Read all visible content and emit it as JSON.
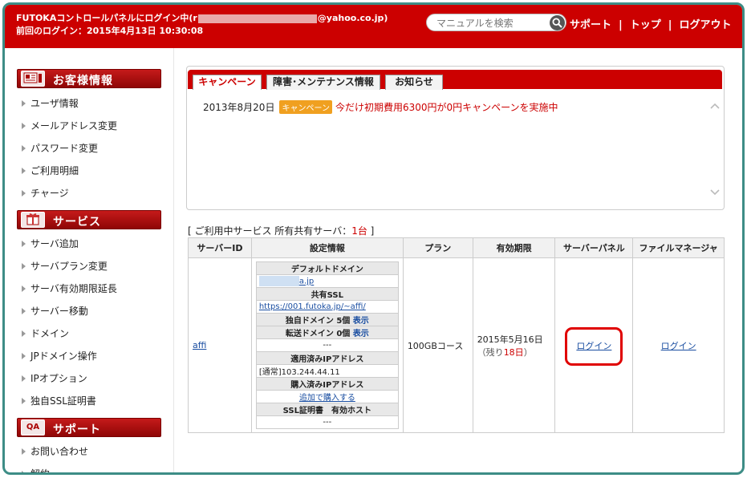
{
  "header": {
    "login_prefix": "FUTOKAコントロールパネルにログイン中(r",
    "login_suffix": "@yahoo.co.jp)",
    "last_login": "前回のログイン：2015年4月13日 10:30:08",
    "search_placeholder": "マニュアルを検索",
    "links": [
      "サポート",
      "トップ",
      "ログアウト"
    ],
    "separator": "|"
  },
  "sidebar": {
    "sections": [
      {
        "title": "お客様情報",
        "icon": "customer-card-icon",
        "items": [
          "ユーザ情報",
          "メールアドレス変更",
          "パスワード変更",
          "ご利用明細",
          "チャージ"
        ]
      },
      {
        "title": "サービス",
        "icon": "gift-box-icon",
        "items": [
          "サーバ追加",
          "サーバプラン変更",
          "サーバ有効期限延長",
          "サーバー移動",
          "ドメイン",
          "JPドメイン操作",
          "IPオプション",
          "独自SSL証明書"
        ]
      },
      {
        "title": "サポート",
        "icon_text": "QA",
        "items": [
          "お問い合わせ",
          "解約"
        ]
      }
    ]
  },
  "campaign": {
    "tabs": [
      "キャンペーン",
      "障害･メンテナンス情報",
      "お知らせ"
    ],
    "active_tab": 0,
    "news": [
      {
        "date": "2013年8月20日",
        "badge": "キャンペーン",
        "text": "今だけ初期費用6300円が0円キャンペーンを実施中"
      }
    ]
  },
  "service": {
    "caption_prefix": "[ ご利用中サービス 所有共有サーバ：",
    "caption_count": "1台",
    "caption_suffix": " ]",
    "columns": [
      "サーバーID",
      "設定情報",
      "プラン",
      "有効期限",
      "サーバーパネル",
      "ファイルマネージャ"
    ],
    "row": {
      "server_id": "affi",
      "settings": {
        "default_domain_label": "デフォルトドメイン",
        "default_domain_value": "a.jp",
        "shared_ssl_label": "共有SSL",
        "shared_ssl_value": "https://001.futoka.jp/~affi/",
        "own_domain_label": "独自ドメイン 5個",
        "own_domain_show": "表示",
        "transfer_domain_label": "転送ドメイン 0個",
        "transfer_domain_show": "表示",
        "dash1": "---",
        "applied_ip_label": "適用済みIPアドレス",
        "applied_ip_value": "[通常]103.244.44.11",
        "purchased_ip_label": "購入済みIPアドレス",
        "purchase_link": "追加で購入する",
        "ssl_cert_label": "SSL証明書　有効ホスト",
        "dash2": "---"
      },
      "plan": "100GBコース",
      "expiry_date": "2015年5月16日",
      "remaining_prefix": "（残り",
      "remaining_days": "18日",
      "remaining_suffix": "）",
      "server_panel_link": "ログイン",
      "file_manager_link": "ログイン"
    }
  },
  "colors": {
    "brand_red": "#cc0000",
    "frame_teal": "#3d8d86",
    "badge_orange": "#f0a020",
    "link_blue": "#1a4ea1",
    "highlight_circle": "#e00000"
  }
}
